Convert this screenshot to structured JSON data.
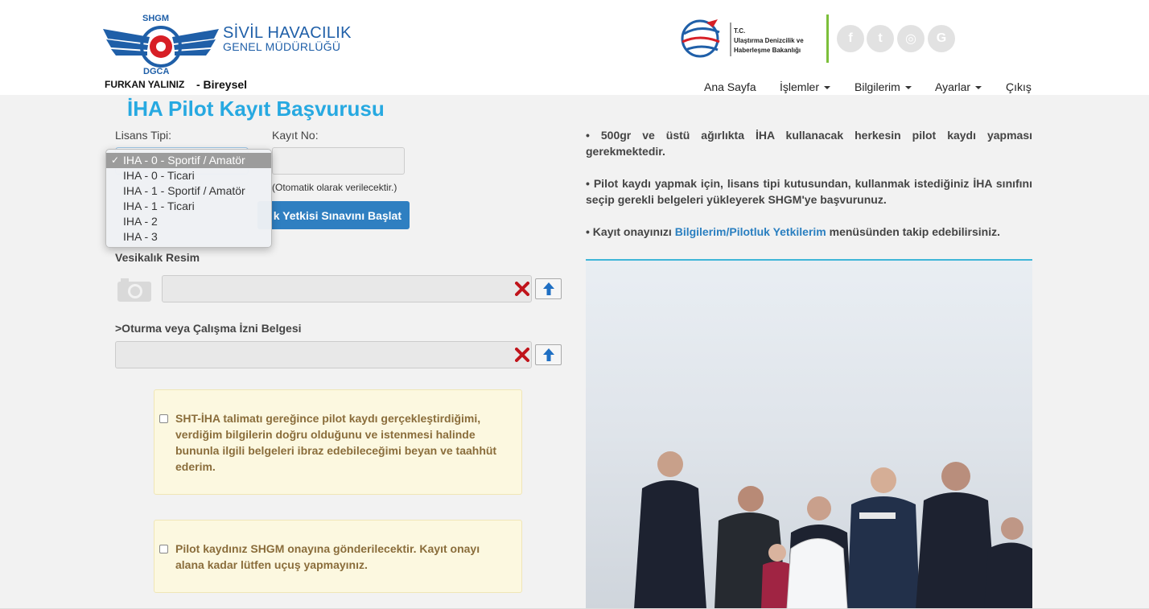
{
  "header": {
    "logo_title": "SİVİL HAVACILIK",
    "logo_subtitle": "GENEL MÜDÜRLÜĞÜ",
    "logo_ring_top": "SHGM",
    "logo_ring_bottom": "DGCA",
    "user_name": "FURKAN YALINIZ",
    "user_role": "- Bireysel",
    "ministry_text": [
      "T.C.",
      "Ulaştırma Denizcilik ve",
      "Haberleşme Bakanlığı"
    ],
    "social": [
      {
        "icon": "facebook-icon",
        "glyph": "f"
      },
      {
        "icon": "twitter-icon",
        "glyph": "t"
      },
      {
        "icon": "instagram-icon",
        "glyph": "◎"
      },
      {
        "icon": "google-icon",
        "glyph": "G"
      }
    ],
    "nav": {
      "home": "Ana Sayfa",
      "operations": "İşlemler",
      "my_info": "Bilgilerim",
      "settings": "Ayarlar",
      "logout": "Çıkış"
    }
  },
  "form": {
    "title": "İHA Pilot Kayıt Başvurusu",
    "license_label": "Lisans Tipi:",
    "record_label": "Kayıt No:",
    "record_value": "",
    "auto_note": "(Otomatik olarak verilecektir.)",
    "exam_button": "k Yetkisi Sınavını Başlat",
    "license_options": [
      "IHA - 0 - Sportif / Amatör",
      "IHA - 0 - Ticari",
      "IHA - 1 - Sportif / Amatör",
      "IHA - 1 - Ticari",
      "IHA - 2",
      "IHA - 3"
    ],
    "selected_option": "IHA - 0 - Sportif / Amatör",
    "photo_label": "Vesikalık Resim",
    "permit_label": ">Oturma veya Çalışma İzni Belgesi",
    "declaration_1": "SHT-İHA talimatı gereğince pilot kaydı gerçekleştirdiğimi, verdiğim bilgilerin doğru olduğunu ve istenmesi halinde bununla ilgili belgeleri ibraz edebileceğimi beyan ve taahhüt ederim.",
    "declaration_2": "Pilot kaydınız SHGM onayına gönderilecektir. Kayıt onayı alana kadar lütfen uçuş yapmayınız."
  },
  "info": {
    "item1": "• 500gr ve üstü ağırlıkta İHA kullanacak herkesin pilot kaydı yapması gerekmektedir.",
    "item2": "• Pilot kaydı yapmak için, lisans tipi kutusundan, kullanmak istediğiniz İHA sınıfını seçip gerekli belgeleri yükleyerek SHGM'ye başvurunuz.",
    "item3_prefix": "• Kayıt onayınızı ",
    "item3_link": "Bilgilerim/Pilotluk Yetkilerim",
    "item3_suffix": " menüsünden takip edebilirsiniz."
  },
  "colors": {
    "brand_blue": "#1f5fa8",
    "title_blue": "#27a9e1",
    "button_blue": "#2f7fc1",
    "warning_bg": "#fcf8e0",
    "warning_text": "#8a6d3b",
    "divider_green": "#7cbf3a"
  }
}
